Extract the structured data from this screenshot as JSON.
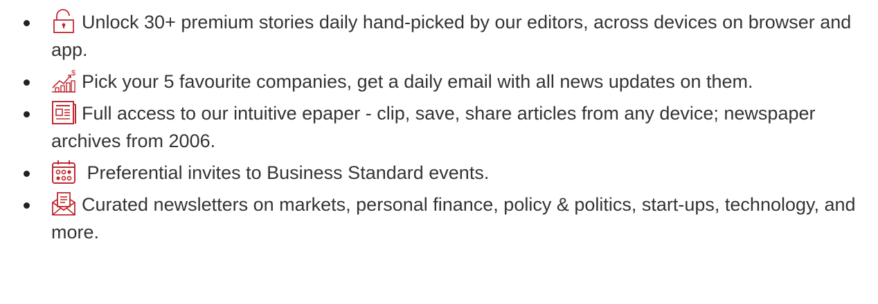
{
  "accent_color": "#c0272d",
  "benefits": [
    {
      "icon": "unlock-icon",
      "text": "Unlock 30+ premium stories daily hand-picked by our editors, across devices on browser and app."
    },
    {
      "icon": "growth-chart-icon",
      "text": "Pick your 5 favourite companies, get a daily email with all news updates on them."
    },
    {
      "icon": "epaper-icon",
      "text": "Full access to our intuitive epaper - clip, save, share articles from any device; newspaper archives from 2006."
    },
    {
      "icon": "calendar-icon",
      "text": " Preferential invites to Business Standard events."
    },
    {
      "icon": "newsletter-icon",
      "text": "Curated newsletters on markets, personal finance, policy & politics, start-ups, technology, and more."
    }
  ]
}
